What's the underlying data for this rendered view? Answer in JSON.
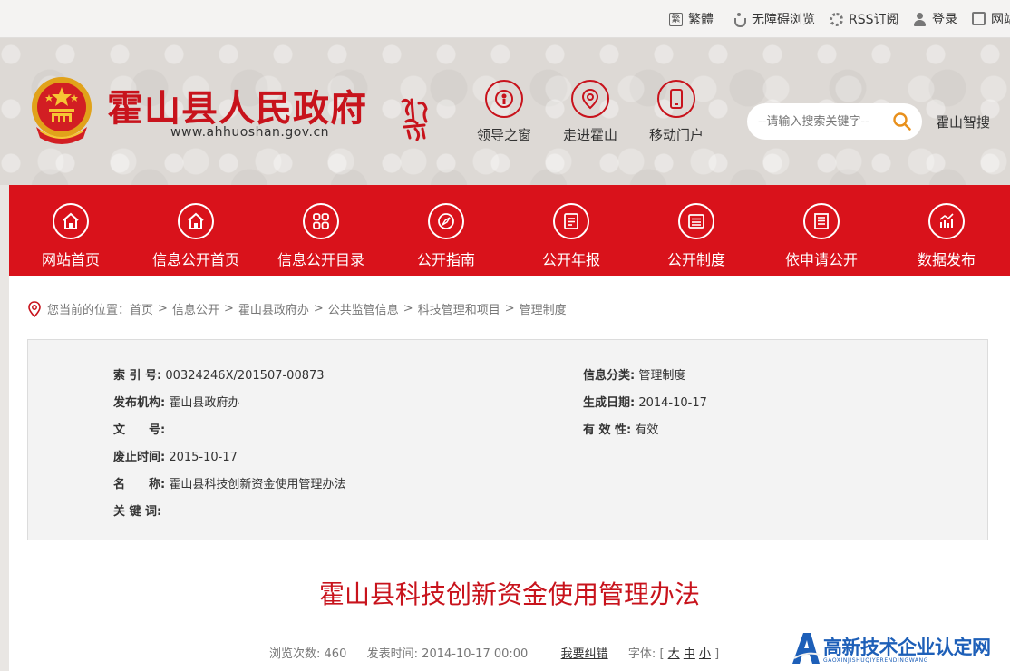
{
  "topbar": {
    "traditional": "繁體",
    "traditional_icon_char": "繁",
    "accessibility": "无障碍浏览",
    "rss": "RSS订阅",
    "login": "登录",
    "site_nav": "网站"
  },
  "header": {
    "title": "霍山县人民政府",
    "url": "www.ahhuoshan.gov.cn",
    "quick_links": [
      {
        "label": "领导之窗",
        "icon": "leader-icon"
      },
      {
        "label": "走进霍山",
        "icon": "location-pin-icon"
      },
      {
        "label": "移动门户",
        "icon": "mobile-icon"
      }
    ],
    "search_placeholder": "--请输入搜索关键字--",
    "smart_link": "霍山智搜"
  },
  "nav": [
    {
      "label": "网站首页",
      "icon": "home-icon"
    },
    {
      "label": "信息公开首页",
      "icon": "home-icon"
    },
    {
      "label": "信息公开目录",
      "icon": "grid-icon"
    },
    {
      "label": "公开指南",
      "icon": "compass-icon"
    },
    {
      "label": "公开年报",
      "icon": "report-icon"
    },
    {
      "label": "公开制度",
      "icon": "list-icon"
    },
    {
      "label": "依申请公开",
      "icon": "form-icon"
    },
    {
      "label": "数据发布",
      "icon": "chart-icon"
    }
  ],
  "breadcrumb": {
    "prefix": "您当前的位置：",
    "items": [
      "首页",
      "信息公开",
      "霍山县政府办",
      "公共监管信息",
      "科技管理和项目",
      "管理制度"
    ],
    "separator": ">"
  },
  "meta": {
    "index_label": "索 引 号:",
    "index_value": "00324246X/201507-00873",
    "category_label": "信息分类:",
    "category_value": "管理制度",
    "publisher_label": "发布机构:",
    "publisher_value": "霍山县政府办",
    "date_label": "生成日期:",
    "date_value": "2014-10-17",
    "docno_label": "文　　号:",
    "docno_value": "",
    "validity_label": "有 效 性:",
    "validity_value": "有效",
    "expire_label": "废止时间:",
    "expire_value": "2015-10-17",
    "name_label": "名　　称:",
    "name_value": "霍山县科技创新资金使用管理办法",
    "keywords_label": "关 键 词:",
    "keywords_value": ""
  },
  "article": {
    "title": "霍山县科技创新资金使用管理办法",
    "views_label": "浏览次数:",
    "views_value": "460",
    "published_label": "发表时间:",
    "published_value": "2014-10-17 00:00",
    "correction_link": "我要纠错",
    "font_label": "字体:",
    "font_open": "[",
    "font_large": "大",
    "font_medium": "中",
    "font_small": "小",
    "font_close": "]"
  },
  "watermark": {
    "title": "高新技术企业认定网",
    "subtitle": "GAOXINJISHUQIYERENDINGWANG"
  },
  "colors": {
    "brand_red": "#d9121b",
    "title_red": "#c8131c",
    "watermark_blue": "#1d5fb8"
  }
}
